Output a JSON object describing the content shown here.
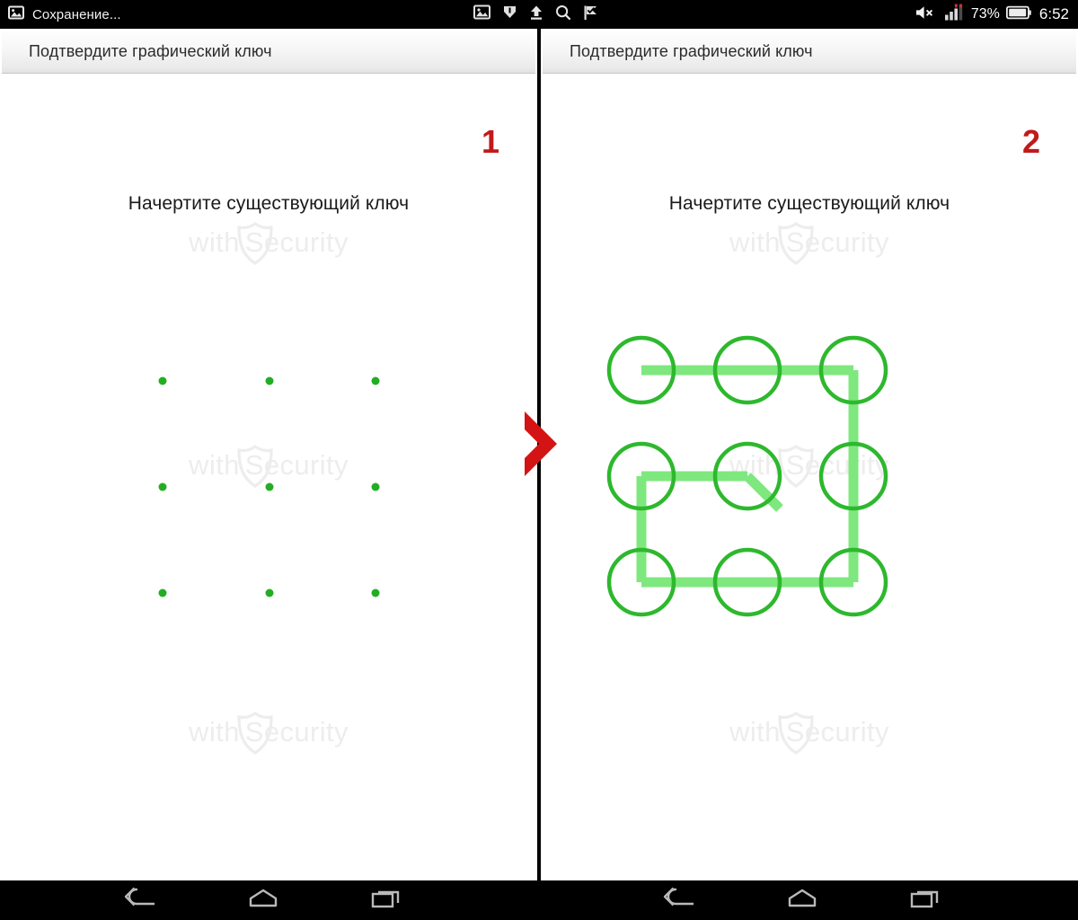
{
  "status_bar": {
    "notification_text": "Сохранение...",
    "notification_icon": "image-icon",
    "mid_icons": [
      "image-icon",
      "download-icon",
      "upload-icon",
      "search-icon",
      "flag-check-icon"
    ],
    "volume_mute_icon": "volume-mute-icon",
    "signal_icon": "signal-bars-icon",
    "battery_percent": "73%",
    "battery_icon": "battery-icon",
    "clock": "6:52",
    "background": "#000000",
    "text_color": "#ffffff"
  },
  "panels": [
    {
      "id": "panel-1",
      "title": "Подтвердите графический ключ",
      "step_number": "1",
      "instruction": "Начертите существующий ключ",
      "pattern_state": "empty",
      "dot_color": "#23ad23"
    },
    {
      "id": "panel-2",
      "title": "Подтвердите графический ключ",
      "step_number": "2",
      "instruction": "Начертите существующий ключ",
      "pattern_state": "drawn",
      "circle_color": "#2db82d",
      "line_color": "#7ee87e"
    }
  ],
  "watermark": {
    "text_before": "with",
    "text_after": "Security",
    "shield_icon": "shield-icon",
    "color": "#ededed"
  },
  "step_arrow": {
    "icon": "chevron-right-icon",
    "color": "#d41414"
  },
  "step_number_color": "#c21a1a",
  "pattern": {
    "grid_size": 3,
    "cell_spacing": 118,
    "circle_radius": 36,
    "sequence": [
      "top-left",
      "top-middle",
      "top-right",
      "middle-right",
      "bottom-right",
      "bottom-middle",
      "bottom-left",
      "middle-left",
      "center"
    ],
    "trailing_stub": "center-down-right"
  },
  "nav_bar": {
    "buttons": [
      "back-icon",
      "home-icon",
      "recents-icon"
    ],
    "background": "#000000",
    "icon_color": "#b9b9b9"
  }
}
